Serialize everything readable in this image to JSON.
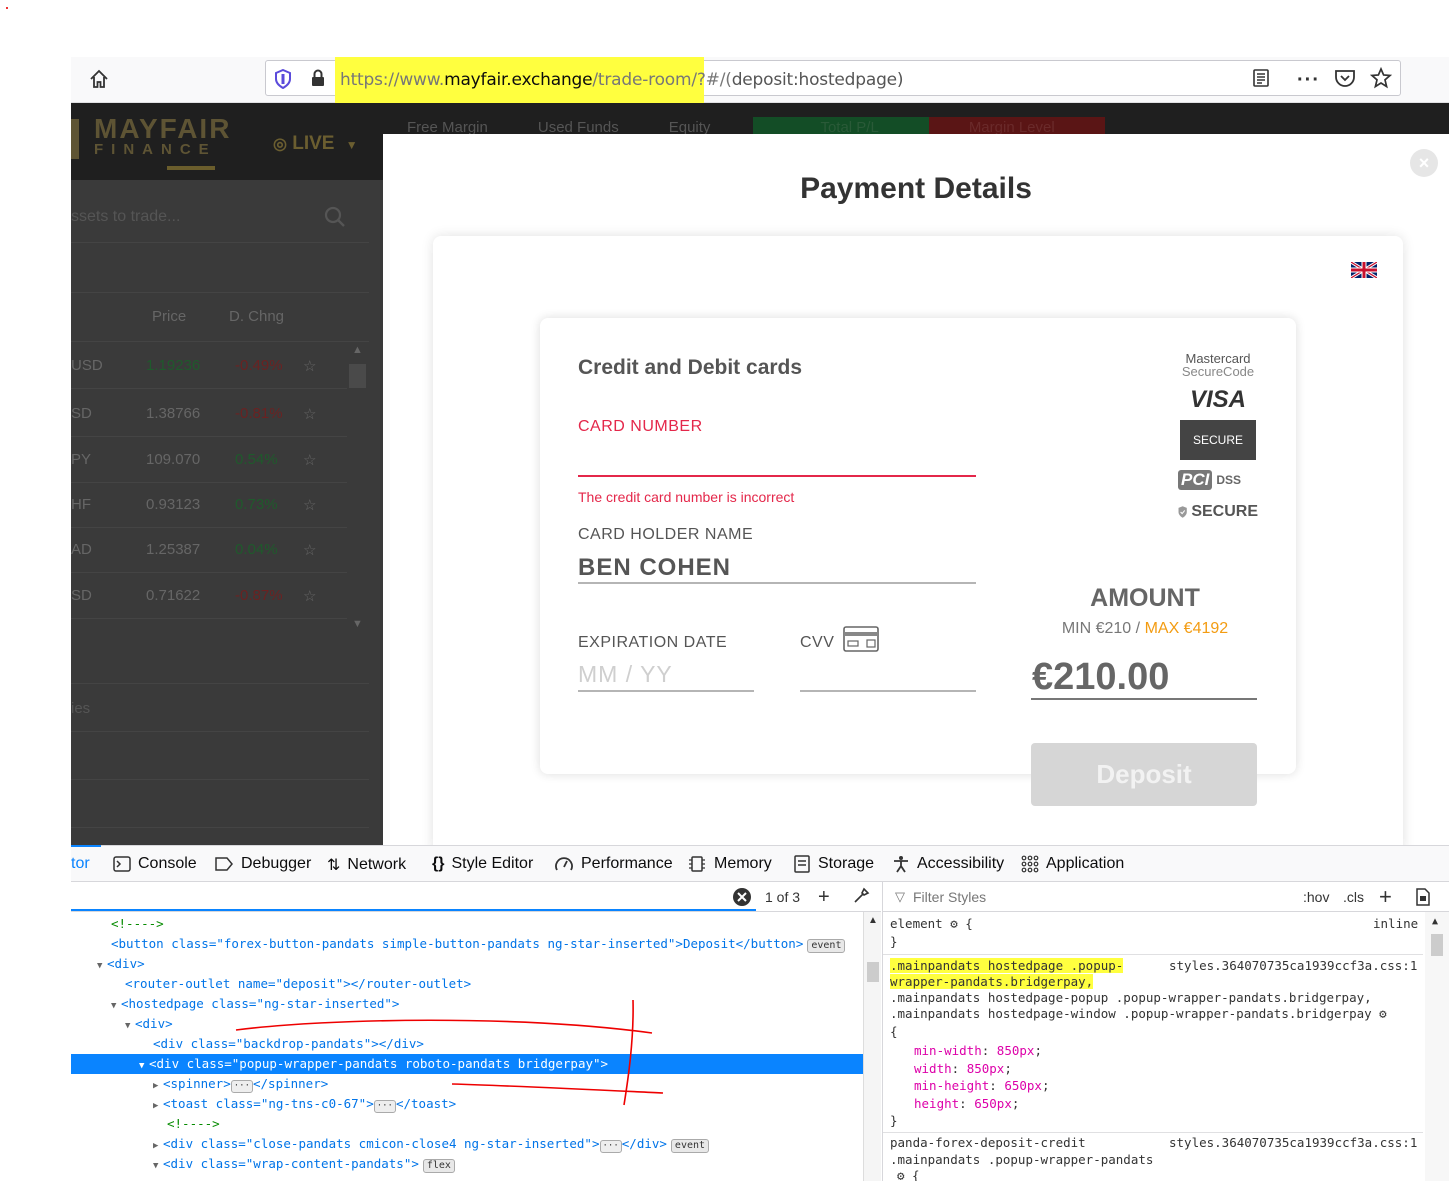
{
  "browser": {
    "url_prefix": "https://www.",
    "url_domain": "mayfair.exchange",
    "url_path": "/trade-room/?#/(",
    "url_tail": "deposit:hostedpage)"
  },
  "app": {
    "logo_top": "MAYFAIR",
    "logo_bottom": "FINANCE",
    "live_label": "LIVE",
    "stats": [
      "Free Margin",
      "Used Funds",
      "Equity",
      "Total P/L",
      "Margin Level"
    ],
    "search_placeholder": "ssets to trade...",
    "col_price": "Price",
    "col_change": "D. Chng",
    "quotes": [
      {
        "symbol": "USD",
        "price": "1.19236",
        "change": "-0.49%"
      },
      {
        "symbol": "SD",
        "price": "1.38766",
        "change": "-0.81%"
      },
      {
        "symbol": "PY",
        "price": "109.070",
        "change": "0.54%"
      },
      {
        "symbol": "HF",
        "price": "0.93123",
        "change": "0.73%"
      },
      {
        "symbol": "AD",
        "price": "1.25387",
        "change": "0.04%"
      },
      {
        "symbol": "SD",
        "price": "0.71622",
        "change": "-0.87%"
      }
    ],
    "lower_label": "ies"
  },
  "modal": {
    "title": "Payment Details",
    "close": "×",
    "card_section_title": "Credit and Debit cards",
    "card_number_label": "CARD NUMBER",
    "card_number_error": "The credit card number is incorrect",
    "holder_label": "CARD HOLDER NAME",
    "holder_value": "BEN COHEN",
    "expiry_label": "EXPIRATION DATE",
    "expiry_placeholder": "MM / YY",
    "cvv_label": "CVV",
    "amount_label": "AMOUNT",
    "min_text": "MIN €210",
    "separator": "/",
    "max_text": "MAX €4192",
    "amount_value": "€210.00",
    "deposit_label": "Deposit",
    "logos": {
      "mastercard_line1": "Mastercard",
      "mastercard_line2": "SecureCode",
      "visa": "VISA",
      "visa_secure": "SECURE",
      "pci": "PCI",
      "dss": "DSS",
      "ssl": "SECURE"
    }
  },
  "devtools": {
    "tabs": [
      "tor",
      "Console",
      "Debugger",
      "Network",
      "Style Editor",
      "Performance",
      "Memory",
      "Storage",
      "Accessibility",
      "Application"
    ],
    "search_count": "1 of 3",
    "filter_placeholder": "Filter Styles",
    "hov": ":hov",
    "cls": ".cls",
    "markup": [
      "<!---->",
      "<button class=\"forex-button-pandats simple-button-pandats ng-star-inserted\">Deposit</button>",
      "<div>",
      "<router-outlet name=\"deposit\"></router-outlet>",
      "<hostedpage class=\"ng-star-inserted\">",
      "<div>",
      "<div class=\"backdrop-pandats\"></div>",
      "<div class=\"popup-wrapper-pandats roboto-pandats bridgerpay\">",
      "<spinner>",
      "<toast class=\"ng-tns-c0-67\">",
      "<!---->",
      "<div class=\"close-pandats cmicon-close4 ng-star-inserted\">",
      "<div class=\"wrap-content-pandats\">"
    ],
    "rules": {
      "element": "element",
      "inline": "inline",
      "sel1a": ".mainpandats hostedpage .popup-",
      "sel1b": "wrapper-pandats.bridgerpay,",
      "sel1c": ".mainpandats hostedpage-popup .popup-wrapper-pandats.bridgerpay,",
      "sel1d": ".mainpandats hostedpage-window .popup-wrapper-pandats.bridgerpay",
      "src1": "styles.364070735ca1939ccf3a.css:1",
      "props": [
        {
          "name": "min-width",
          "value": "850px"
        },
        {
          "name": "width",
          "value": "850px"
        },
        {
          "name": "min-height",
          "value": "650px"
        },
        {
          "name": "height",
          "value": "650px"
        }
      ],
      "sel2a": "panda-forex-deposit-credit",
      "sel2b": ".mainpandats .popup-wrapper-pandats",
      "src2": "styles.364070735ca1939ccf3a.css:1"
    }
  }
}
